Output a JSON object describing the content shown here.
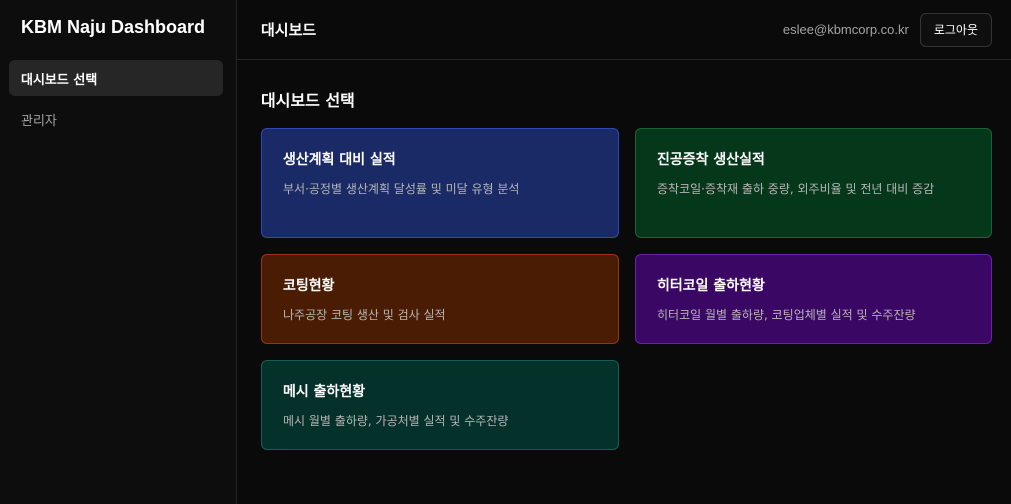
{
  "app": {
    "title": "KBM Naju Dashboard"
  },
  "sidebar": {
    "items": [
      {
        "label": "대시보드 선택",
        "active": true
      },
      {
        "label": "관리자",
        "active": false
      }
    ]
  },
  "header": {
    "title": "대시보드",
    "user_email": "eslee@kbmcorp.co.kr",
    "logout_label": "로그아웃"
  },
  "main": {
    "section_title": "대시보드 선택",
    "cards": [
      {
        "title": "생산계획 대비 실적",
        "description": "부서·공정별 생산계획 달성률 및 미달 유형 분석",
        "bg": "#1a2a66",
        "border": "#2f47b8"
      },
      {
        "title": "진공증착 생산실적",
        "description": "증착코일·증착재 출하 중량, 외주비율 및 전년 대비 증감",
        "bg": "#05381a",
        "border": "#166534"
      },
      {
        "title": "코팅현황",
        "description": "나주공장 코팅 생산 및 검사 실적",
        "bg": "#4a1c03",
        "border": "#9a3412"
      },
      {
        "title": "히터코일 출하현황",
        "description": "히터코일 월별 출하량, 코팅업체별 실적 및 수주잔량",
        "bg": "#3b0764",
        "border": "#6b21a8"
      },
      {
        "title": "메시 출하현황",
        "description": "메시 월별 출하량, 가공처별 실적 및 수주잔량",
        "bg": "#05312b",
        "border": "#115e59"
      }
    ]
  }
}
